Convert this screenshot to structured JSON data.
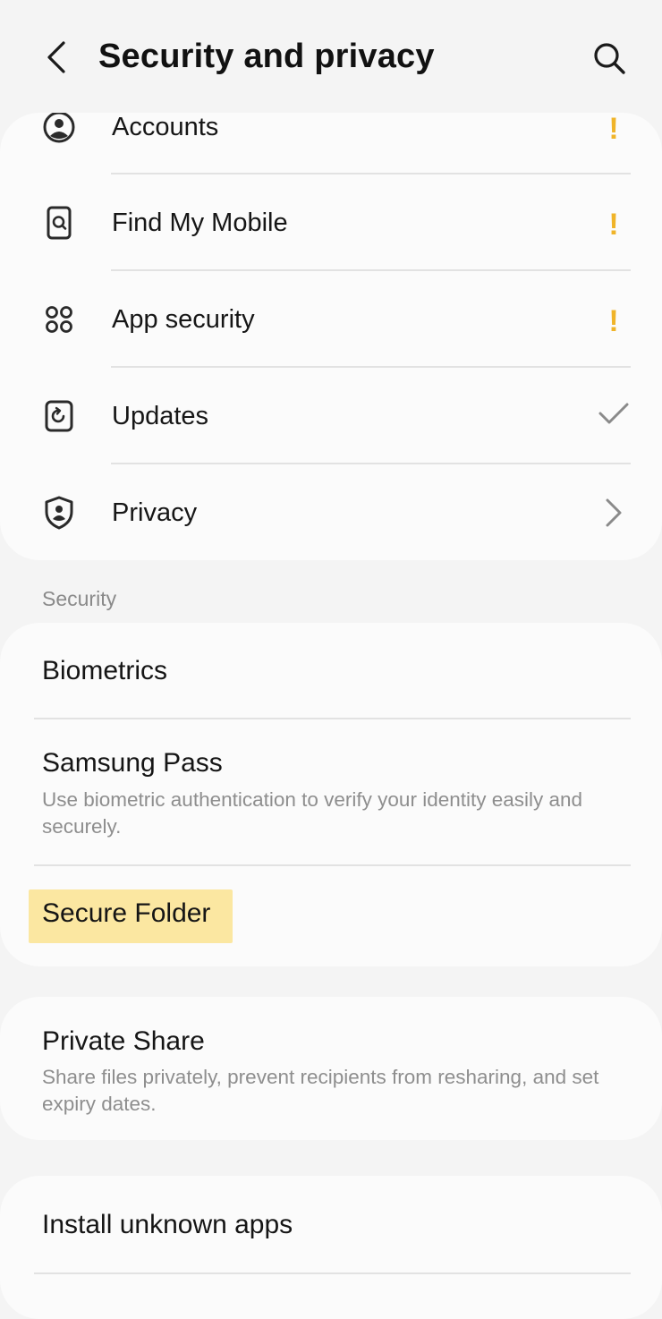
{
  "header": {
    "title": "Security and privacy",
    "back_icon": "chevron-left-icon",
    "search_icon": "search-icon"
  },
  "top_group": {
    "items": [
      {
        "label": "Accounts",
        "icon": "account-circle-icon",
        "status": "!",
        "status_type": "warning"
      },
      {
        "label": "Find My Mobile",
        "icon": "find-my-mobile-icon",
        "status": "!",
        "status_type": "warning"
      },
      {
        "label": "App security",
        "icon": "app-security-icon",
        "status": "!",
        "status_type": "warning"
      },
      {
        "label": "Updates",
        "icon": "updates-icon",
        "status_type": "check"
      },
      {
        "label": "Privacy",
        "icon": "privacy-shield-icon",
        "status_type": "chevron"
      }
    ]
  },
  "security_section": {
    "header": "Security",
    "items": [
      {
        "title": "Biometrics"
      },
      {
        "title": "Samsung Pass",
        "subtitle": "Use biometric authentication to verify your identity easily and securely."
      },
      {
        "title": "Secure Folder",
        "highlighted": true
      }
    ]
  },
  "private_share": {
    "title": "Private Share",
    "subtitle": "Share files privately, prevent recipients from resharing, and set expiry dates."
  },
  "install_unknown": {
    "title": "Install unknown apps"
  },
  "colors": {
    "background": "#f4f4f4",
    "card": "#fbfbfb",
    "warning": "#f0b429",
    "highlight": "#fbe7a1",
    "secondary_text": "#8e8e8e"
  }
}
